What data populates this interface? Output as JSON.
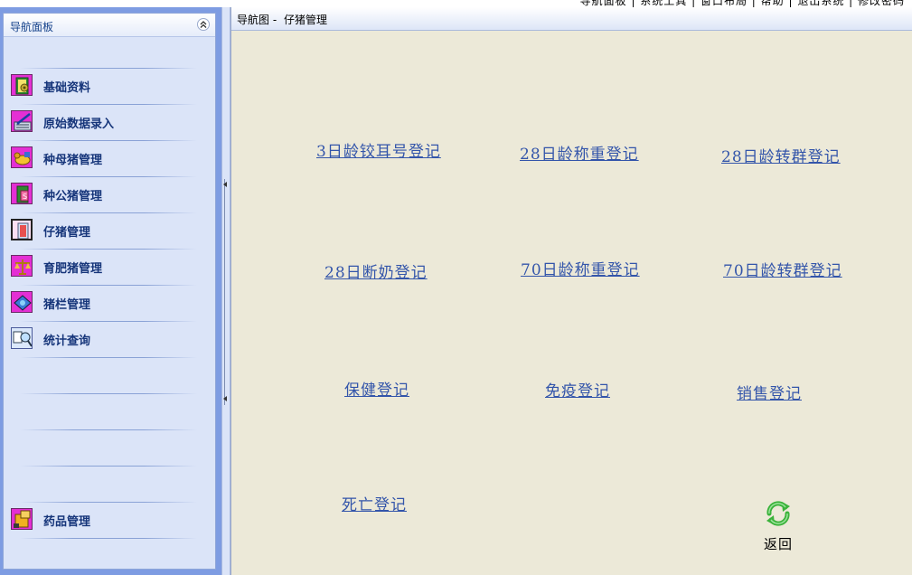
{
  "top_menu_fragment": "导航面板 | 系统工具 | 窗口布局 | 帮助 | 退出系统 | 修改密码",
  "nav": {
    "title": "导航面板",
    "items": [
      {
        "label": "基础资料",
        "icon": "book-gear-icon"
      },
      {
        "label": "原始数据录入",
        "icon": "pen-data-icon"
      },
      {
        "label": "种母猪管理",
        "icon": "sow-icon"
      },
      {
        "label": "种公猪管理",
        "icon": "boar-book-icon"
      },
      {
        "label": "仔猪管理",
        "icon": "piglet-door-icon"
      },
      {
        "label": "育肥猪管理",
        "icon": "scale-icon"
      },
      {
        "label": "猪栏管理",
        "icon": "pen-house-icon"
      },
      {
        "label": "统计查询",
        "icon": "magnifier-icon"
      },
      {
        "label": "药品管理",
        "icon": "medicine-box-icon"
      }
    ]
  },
  "breadcrumb": {
    "prefix": "导航图 -",
    "current": "仔猪管理"
  },
  "links": {
    "ear_tag": "3日龄铰耳号登记",
    "weigh_28": "28日龄称重登记",
    "transfer_28": "28日龄转群登记",
    "weaning_28": "28日断奶登记",
    "weigh_70": "70日龄称重登记",
    "transfer_70": "70日龄转群登记",
    "healthcare": "保健登记",
    "immunization": "免疫登记",
    "sales": "销售登记",
    "death": "死亡登记"
  },
  "back": {
    "label": "返回",
    "icon": "refresh-arrows-icon"
  },
  "colors": {
    "nav_frame": "#7e9ce2",
    "nav_panel": "#dbe4f8",
    "nav_text": "#16357a",
    "main_bg": "#ece9d8",
    "link": "#3355aa",
    "icon_bg": "#e42fd4",
    "back_green": "#3ab23a"
  }
}
